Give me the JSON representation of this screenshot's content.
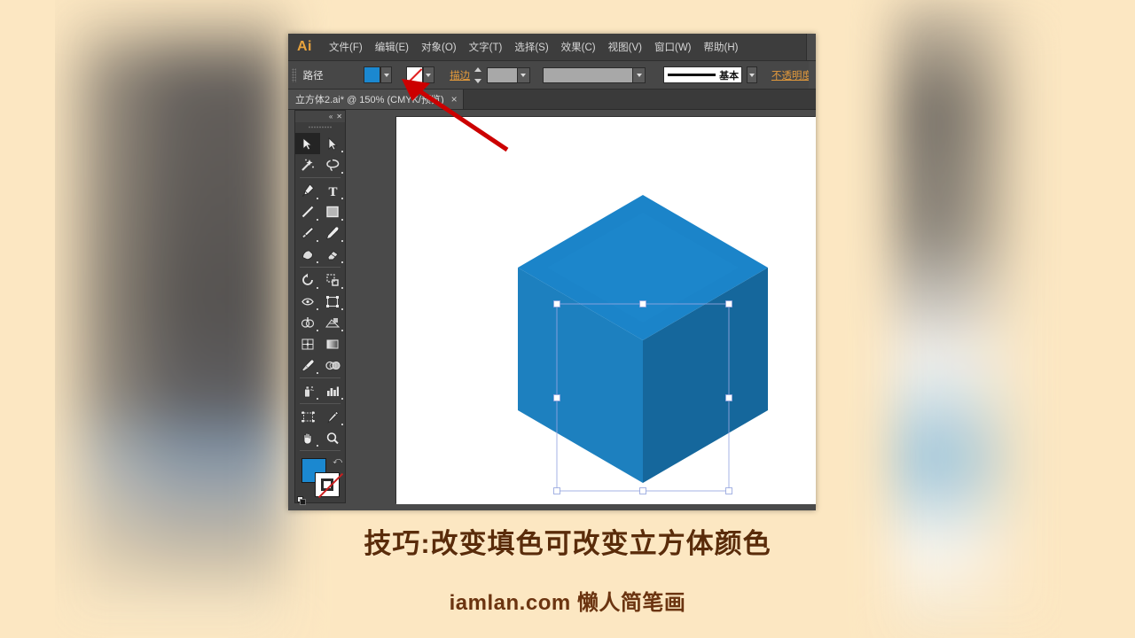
{
  "app": {
    "logo": "Ai",
    "menu": [
      {
        "label": "文件(F)",
        "name": "menu-file"
      },
      {
        "label": "编辑(E)",
        "name": "menu-edit"
      },
      {
        "label": "对象(O)",
        "name": "menu-object"
      },
      {
        "label": "文字(T)",
        "name": "menu-type"
      },
      {
        "label": "选择(S)",
        "name": "menu-select"
      },
      {
        "label": "效果(C)",
        "name": "menu-effect"
      },
      {
        "label": "视图(V)",
        "name": "menu-view"
      },
      {
        "label": "窗口(W)",
        "name": "menu-window"
      },
      {
        "label": "帮助(H)",
        "name": "menu-help"
      }
    ]
  },
  "controlbar": {
    "object_type_label": "路径",
    "fill_color": "#1b88d0",
    "stroke_color_label": "无",
    "stroke_label": "描边",
    "stroke_weight_value": "",
    "stroke_style_value": "",
    "brush_definition_label": "基本",
    "opacity_label": "不透明度"
  },
  "document": {
    "tab_title": "立方体2.ai* @ 150% (CMYK/预览)",
    "close_glyph": "×",
    "zoom_level": "150%",
    "color_mode": "CMYK",
    "view_mode": "预览",
    "file_name": "立方体2.ai",
    "modified": true
  },
  "toolpanel": {
    "collapse_glyph": "«",
    "close_glyph": "✕",
    "tools": [
      {
        "name": "selection-tool",
        "label": "选择工具",
        "active": true
      },
      {
        "name": "direct-selection-tool",
        "label": "直接选择工具",
        "active": false
      },
      {
        "name": "magic-wand-tool",
        "label": "魔棒工具",
        "active": false
      },
      {
        "name": "lasso-tool",
        "label": "套索工具",
        "active": false
      },
      {
        "name": "pen-tool",
        "label": "钢笔工具",
        "active": false
      },
      {
        "name": "type-tool",
        "label": "文字工具",
        "active": false
      },
      {
        "name": "line-segment-tool",
        "label": "直线段工具",
        "active": false
      },
      {
        "name": "rectangle-tool",
        "label": "矩形工具",
        "active": false
      },
      {
        "name": "paintbrush-tool",
        "label": "画笔工具",
        "active": false
      },
      {
        "name": "pencil-tool",
        "label": "铅笔工具",
        "active": false
      },
      {
        "name": "blob-brush-tool",
        "label": "斑点画笔工具",
        "active": false
      },
      {
        "name": "eraser-tool",
        "label": "橡皮擦工具",
        "active": false
      },
      {
        "name": "rotate-tool",
        "label": "旋转工具",
        "active": false
      },
      {
        "name": "scale-tool",
        "label": "比例缩放工具",
        "active": false
      },
      {
        "name": "width-tool",
        "label": "宽度工具",
        "active": false
      },
      {
        "name": "free-transform-tool",
        "label": "自由变换工具",
        "active": false
      },
      {
        "name": "shape-builder-tool",
        "label": "形状生成器工具",
        "active": false
      },
      {
        "name": "perspective-grid-tool",
        "label": "透视网格工具",
        "active": false
      },
      {
        "name": "mesh-tool",
        "label": "网格工具",
        "active": false
      },
      {
        "name": "gradient-tool",
        "label": "渐变工具",
        "active": false
      },
      {
        "name": "eyedropper-tool",
        "label": "吸管工具",
        "active": false
      },
      {
        "name": "blend-tool",
        "label": "混合工具",
        "active": false
      },
      {
        "name": "symbol-sprayer-tool",
        "label": "符号喷枪工具",
        "active": false
      },
      {
        "name": "column-graph-tool",
        "label": "柱形图工具",
        "active": false
      },
      {
        "name": "artboard-tool",
        "label": "画板工具",
        "active": false
      },
      {
        "name": "slice-tool",
        "label": "切片工具",
        "active": false
      },
      {
        "name": "hand-tool",
        "label": "抓手工具",
        "active": false
      },
      {
        "name": "zoom-tool",
        "label": "缩放工具",
        "active": false
      }
    ],
    "fill_color": "#1b88d0",
    "stroke_is_none": true,
    "swap-glyph": "⤺"
  },
  "artwork": {
    "shape": "isometric-cube",
    "face_top_color": "#1b84c9",
    "face_left_color": "#1d80bf",
    "face_right_color": "#15679c",
    "top_highlight_color": "#2089cf",
    "selection_box_color": "#96a6e0",
    "handle_color": "#ffffff",
    "handle_count": 8,
    "canvas_background": "#ffffff"
  },
  "annotation": {
    "arrow_color": "#cc0000",
    "points_to": "fill-color-swatch"
  },
  "captions": {
    "tip": "技巧:改变填色可改变立方体颜色",
    "footer": "iamlan.com 懒人简笔画",
    "tip_color": "#5a2c0a",
    "footer_color": "#6b3410"
  },
  "page": {
    "background_color": "#fce7c2"
  }
}
